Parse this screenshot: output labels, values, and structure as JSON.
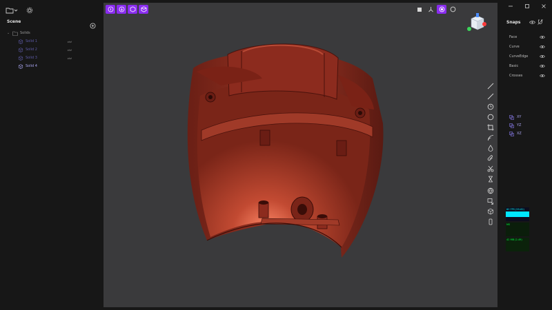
{
  "scene": {
    "title": "Scene",
    "root": {
      "label": "Solids"
    },
    "solids": [
      {
        "label": "Solid 1",
        "badge": "⇄⇄",
        "dim": true
      },
      {
        "label": "Solid 2",
        "badge": "⇄⇄",
        "dim": true
      },
      {
        "label": "Solid 3",
        "badge": "⇄⇄",
        "dim": true
      },
      {
        "label": "Solid 4",
        "badge": "",
        "dim": false
      }
    ]
  },
  "snaps": {
    "title": "Snaps",
    "items": [
      {
        "label": "Face"
      },
      {
        "label": "Curve"
      },
      {
        "label": "CurveEdge"
      },
      {
        "label": "Basic"
      },
      {
        "label": "Crosses"
      }
    ]
  },
  "planes": [
    {
      "label": "XY"
    },
    {
      "label": "YZ"
    },
    {
      "label": "XZ"
    }
  ],
  "stats": {
    "fps": "60 FPS (59-62)",
    "ms": "MS",
    "mb": "42 MB (2-49)",
    "fps_fill": 1.0
  },
  "colors": {
    "accent": "#8a2cf0",
    "model": "#8c2b1e",
    "viewport": "#3a3a3c",
    "background": "#171717"
  }
}
